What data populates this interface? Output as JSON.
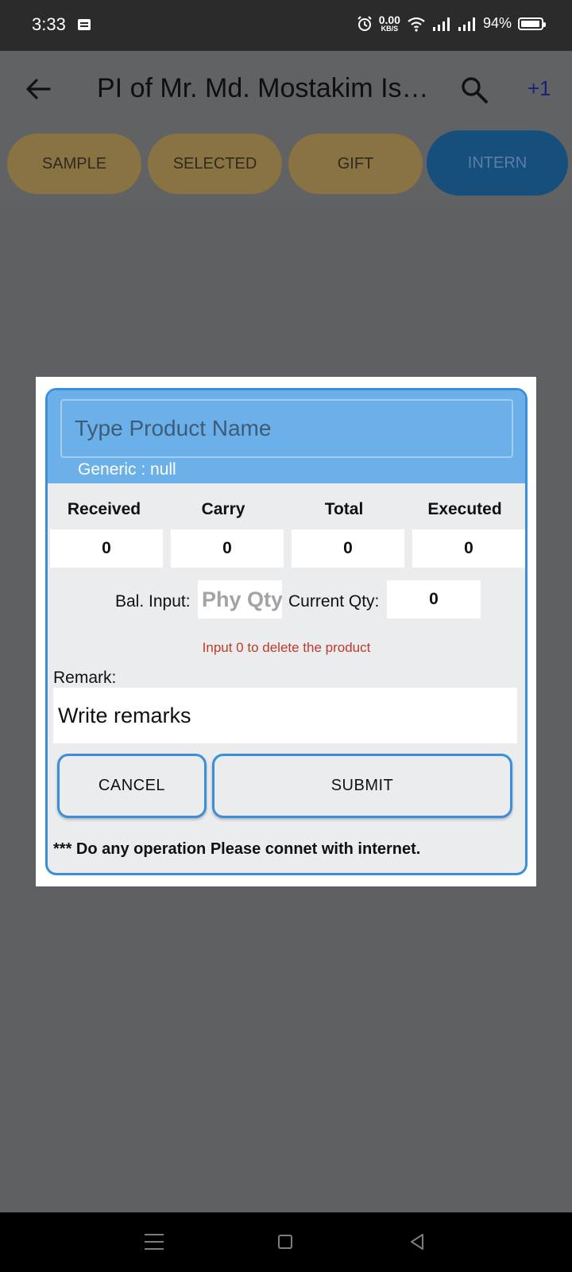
{
  "status_bar": {
    "time": "3:33",
    "net_speed_value": "0.00",
    "net_speed_unit": "KB/S",
    "battery_percent": "94%",
    "battery_level": 0.94,
    "icons": [
      "message-icon",
      "alarm-icon",
      "wifi-icon",
      "signal-icon",
      "signal-icon",
      "battery-icon"
    ]
  },
  "app_bar": {
    "title": "PI of Mr. Md. Mostakim Is…",
    "badge": "+1",
    "icons": [
      "back-arrow-icon",
      "search-icon"
    ]
  },
  "tabs": [
    {
      "label": "SAMPLE",
      "active": false
    },
    {
      "label": "SELECTED",
      "active": false
    },
    {
      "label": "GIFT",
      "active": false
    },
    {
      "label": "INTERN",
      "active": true
    }
  ],
  "dialog": {
    "product_placeholder": "Type Product Name",
    "generic": "Generic : null",
    "columns": [
      {
        "label": "Received",
        "value": "0"
      },
      {
        "label": "Carry",
        "value": "0"
      },
      {
        "label": "Total",
        "value": "0"
      },
      {
        "label": "Executed",
        "value": "0"
      }
    ],
    "bal_input_label": "Bal. Input:",
    "phy_qty_placeholder": "Phy Qty",
    "current_qty_label": "Current Qty:",
    "current_qty_value": "0",
    "delete_hint": "Input 0 to delete the product",
    "remark_label": "Remark:",
    "remark_placeholder": "Write remarks",
    "cancel_label": "CANCEL",
    "submit_label": "SUBMIT",
    "notice": "*** Do any operation Please connet with internet."
  },
  "colors": {
    "accent": "#3b8fd9",
    "header_blue": "#6cb0ea",
    "tab_inactive": "#8a7343",
    "tab_active": "#164e7c",
    "hint_red": "#c0392b"
  }
}
